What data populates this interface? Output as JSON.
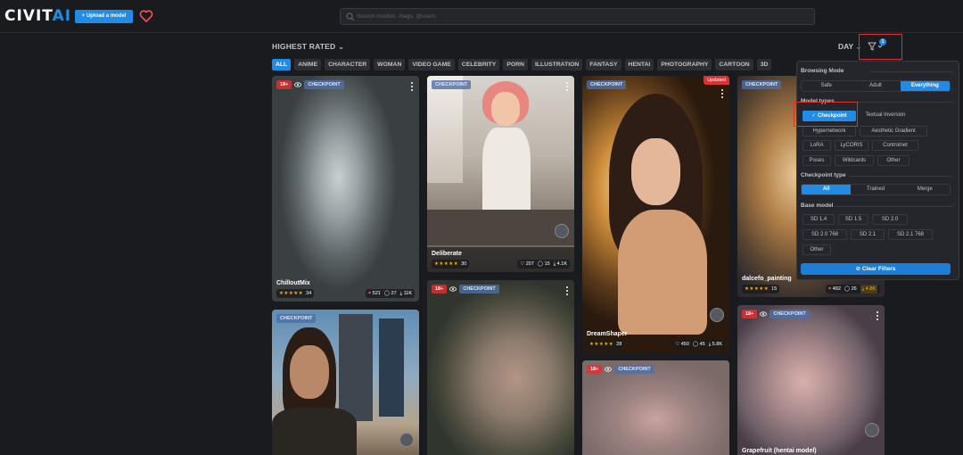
{
  "header": {
    "logo_main": "CIVIT",
    "logo_accent": "AI",
    "upload_label": "+ Upload a model",
    "search_placeholder": "Search models, #tags, @users"
  },
  "sort": {
    "label": "HIGHEST RATED",
    "period": "DAY",
    "filter_count": "1"
  },
  "tags": [
    "ALL",
    "ANIME",
    "CHARACTER",
    "WOMAN",
    "VIDEO GAME",
    "CELEBRITY",
    "PORN",
    "ILLUSTRATION",
    "FANTASY",
    "HENTAI",
    "PHOTOGRAPHY",
    "CARTOON",
    "3D"
  ],
  "cards": [
    {
      "nsfw": "18+",
      "type": "CHECKPOINT",
      "title": "ChilloutMix",
      "stars": "★★★★★",
      "rating_count": "34",
      "likes": "521",
      "comments": "27",
      "downloads": "11K"
    },
    {
      "type": "CHECKPOINT",
      "title": "Deliberate",
      "stars": "★★★★★",
      "rating_count": "30",
      "likes": "207",
      "comments": "15",
      "downloads": "4.1K"
    },
    {
      "type": "CHECKPOINT",
      "updated": "Updated",
      "title": "DreamShaper",
      "stars": "★★★★★",
      "rating_count": "28",
      "likes": "450",
      "comments": "45",
      "downloads": "5.8K"
    },
    {
      "type": "CHECKPOINT",
      "title": "dalcefo_painting",
      "stars": "★★★★★",
      "rating_count": "15",
      "likes": "492",
      "comments": "26",
      "downloads": "4.8K"
    },
    {
      "type": "CHECKPOINT"
    },
    {
      "nsfw": "18+",
      "type": "CHECKPOINT"
    },
    {
      "nsfw": "18+",
      "type": "CHECKPOINT"
    },
    {
      "nsfw": "18+",
      "type": "CHECKPOINT",
      "title": "Grapefruit (hentai model)"
    }
  ],
  "filters": {
    "browsing_mode_label": "Browsing Mode",
    "browsing_modes": [
      "Safe",
      "Adult",
      "Everything"
    ],
    "model_types_label": "Model types",
    "model_types": [
      "Checkpoint",
      "Textual Inversion",
      "Hypernetwork",
      "Aesthetic Gradient",
      "LoRA",
      "LyCORIS",
      "Controlnet",
      "Poses",
      "Wildcards",
      "Other"
    ],
    "checkpoint_type_label": "Checkpoint type",
    "checkpoint_types": [
      "All",
      "Trained",
      "Merge"
    ],
    "base_model_label": "Base model",
    "base_models": [
      "SD 1.4",
      "SD 1.5",
      "SD 2.0",
      "SD 2.0 768",
      "SD 2.1",
      "SD 2.1 768",
      "Other"
    ],
    "clear_label": "Clear Filters"
  },
  "colors": {
    "accent": "#228be6",
    "background": "#1a1b1e",
    "highlight": "#e03131",
    "star": "#fab005"
  }
}
